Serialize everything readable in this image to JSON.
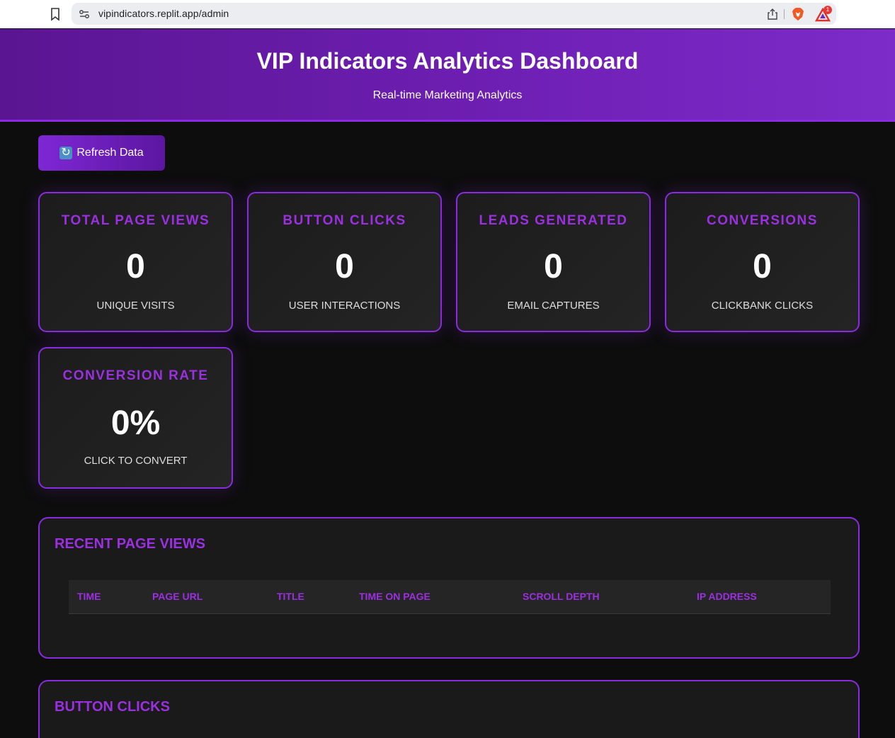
{
  "browser": {
    "url": "vipindicators.replit.app/admin",
    "notification_count": "1"
  },
  "header": {
    "title": "VIP Indicators Analytics Dashboard",
    "subtitle": "Real-time Marketing Analytics"
  },
  "toolbar": {
    "refresh_label": "Refresh Data"
  },
  "stats": [
    {
      "label": "TOTAL PAGE VIEWS",
      "value": "0",
      "caption": "UNIQUE VISITS"
    },
    {
      "label": "BUTTON CLICKS",
      "value": "0",
      "caption": "USER INTERACTIONS"
    },
    {
      "label": "LEADS GENERATED",
      "value": "0",
      "caption": "EMAIL CAPTURES"
    },
    {
      "label": "CONVERSIONS",
      "value": "0",
      "caption": "CLICKBANK CLICKS"
    },
    {
      "label": "CONVERSION RATE",
      "value": "0%",
      "caption": "CLICK TO CONVERT"
    }
  ],
  "recent_page_views": {
    "title": "RECENT PAGE VIEWS",
    "columns": [
      "TIME",
      "PAGE URL",
      "TITLE",
      "TIME ON PAGE",
      "SCROLL DEPTH",
      "IP ADDRESS"
    ],
    "rows": []
  },
  "button_clicks": {
    "title": "BUTTON CLICKS"
  },
  "colors": {
    "accent": "#8a2be2",
    "accent_text": "#9b30e0",
    "background": "#0d0d0d",
    "card": "#1c1c1c"
  }
}
